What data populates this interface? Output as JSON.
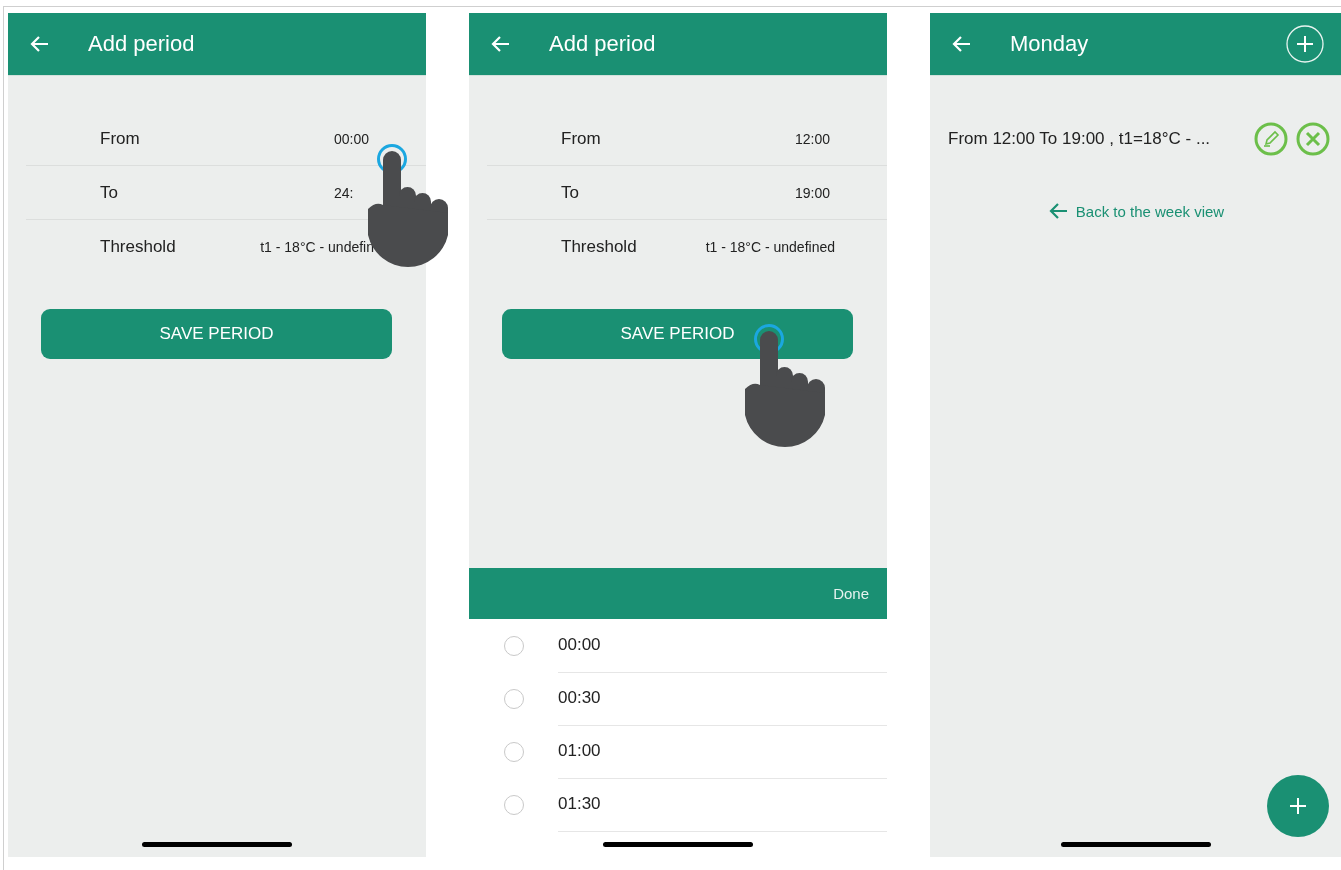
{
  "screens": [
    {
      "kind": "form",
      "header": {
        "title": "Add period"
      },
      "fields": [
        {
          "label": "From",
          "value": "00:00",
          "touched": true
        },
        {
          "label": "To",
          "value": "24:",
          "touched": false
        },
        {
          "label": "Threshold",
          "value": "t1 - 18°C - undefin",
          "touched": false
        }
      ],
      "save_button": {
        "label": "SAVE PERIOD",
        "touched": false
      }
    },
    {
      "kind": "form",
      "header": {
        "title": "Add period"
      },
      "fields": [
        {
          "label": "From",
          "value": "12:00",
          "touched": false
        },
        {
          "label": "To",
          "value": "19:00",
          "touched": false
        },
        {
          "label": "Threshold",
          "value": "t1 - 18°C - undefined",
          "touched": false
        }
      ],
      "save_button": {
        "label": "SAVE PERIOD",
        "touched": true
      },
      "picker": {
        "action": "Done",
        "options": [
          {
            "label": "00:00",
            "selected": false
          },
          {
            "label": "00:30",
            "selected": false
          },
          {
            "label": "01:00",
            "selected": false
          },
          {
            "label": "01:30",
            "selected": false
          }
        ]
      }
    },
    {
      "kind": "day",
      "header": {
        "title": "Monday"
      },
      "periods": [
        {
          "text": "From 12:00 To 19:00 , t1=18°C - ..."
        }
      ],
      "back_link": "Back to the week view"
    }
  ]
}
